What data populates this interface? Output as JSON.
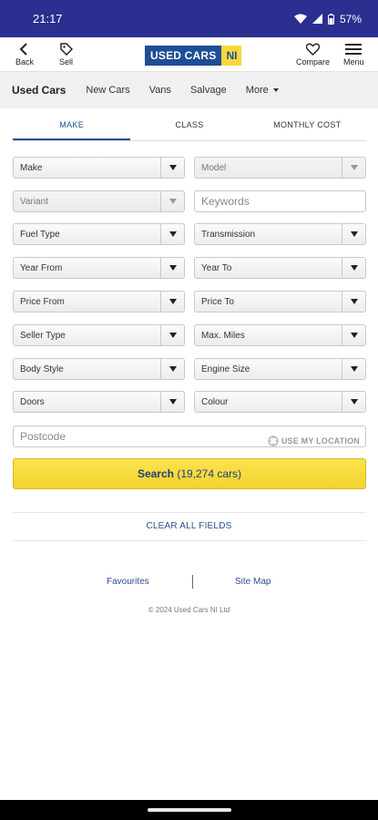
{
  "status_bar": {
    "time": "21:17",
    "battery": "57%"
  },
  "header": {
    "back_label": "Back",
    "sell_label": "Sell",
    "logo_main": "USED CARS",
    "logo_region": "NI",
    "compare_label": "Compare",
    "menu_label": "Menu"
  },
  "nav": {
    "items": [
      {
        "label": "Used Cars"
      },
      {
        "label": "New Cars"
      },
      {
        "label": "Vans"
      },
      {
        "label": "Salvage"
      },
      {
        "label": "More"
      }
    ]
  },
  "search_tabs": [
    {
      "label": "MAKE",
      "active": true
    },
    {
      "label": "CLASS",
      "active": false
    },
    {
      "label": "MONTHLY COST",
      "active": false
    }
  ],
  "fields": {
    "make": "Make",
    "model": "Model",
    "variant": "Variant",
    "keywords_placeholder": "Keywords",
    "fuel_type": "Fuel Type",
    "transmission": "Transmission",
    "year_from": "Year From",
    "year_to": "Year To",
    "price_from": "Price From",
    "price_to": "Price To",
    "seller_type": "Seller Type",
    "max_miles": "Max. Miles",
    "body_style": "Body Style",
    "engine_size": "Engine Size",
    "doors": "Doors",
    "colour": "Colour",
    "postcode_placeholder": "Postcode",
    "use_location": "USE MY LOCATION"
  },
  "search_button": {
    "label": "Search",
    "count": "(19,274 cars)"
  },
  "clear_all": "CLEAR ALL FIELDS",
  "footer": {
    "favourites": "Favourites",
    "site_map": "Site Map",
    "copyright": "© 2024 Used Cars NI Ltd"
  },
  "colors": {
    "brand_blue": "#1e4e96",
    "brand_yellow": "#f6d83a",
    "status_bar": "#2b2f8f",
    "link_blue": "#2d4f8e"
  }
}
